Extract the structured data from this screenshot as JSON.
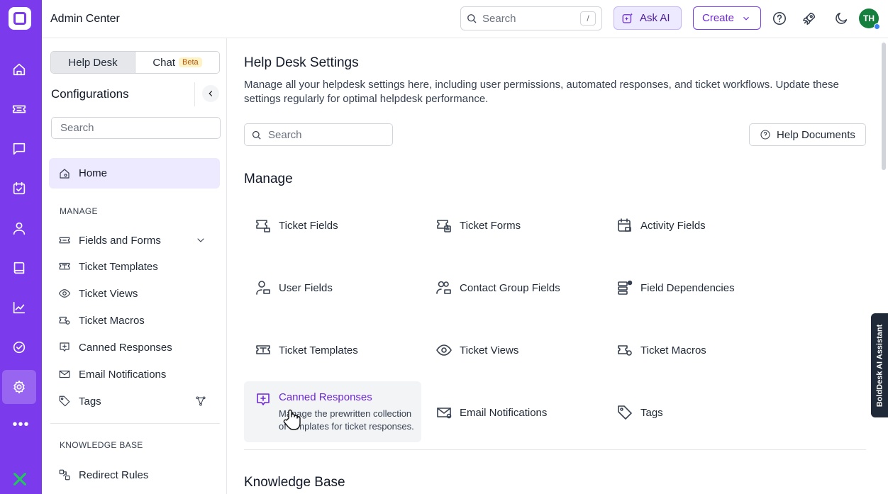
{
  "app": {
    "title": "Admin Center"
  },
  "topbar": {
    "search_placeholder": "Search",
    "search_shortcut": "/",
    "ask_ai_label": "Ask AI",
    "create_label": "Create",
    "avatar_initials": "TH"
  },
  "sidebar": {
    "tabs": [
      {
        "label": "Help Desk"
      },
      {
        "label": "Chat"
      }
    ],
    "beta_badge": "Beta",
    "title": "Configurations",
    "search_placeholder": "Search",
    "home_label": "Home",
    "manage_label": "MANAGE",
    "manage_items": [
      {
        "label": "Fields and Forms"
      },
      {
        "label": "Ticket Templates"
      },
      {
        "label": "Ticket Views"
      },
      {
        "label": "Ticket Macros"
      },
      {
        "label": "Canned Responses"
      },
      {
        "label": "Email Notifications"
      },
      {
        "label": "Tags"
      }
    ],
    "kb_label": "KNOWLEDGE BASE",
    "kb_items": [
      {
        "label": "Redirect Rules"
      }
    ]
  },
  "main": {
    "title": "Help Desk Settings",
    "description": "Manage all your helpdesk settings here, including user permissions, automated responses, and ticket workflows. Update these settings regularly for optimal helpdesk performance.",
    "search_placeholder": "Search",
    "help_docs_label": "Help Documents",
    "manage_heading": "Manage",
    "cards": [
      {
        "label": "Ticket Fields"
      },
      {
        "label": "Ticket Forms"
      },
      {
        "label": "Activity Fields"
      },
      {
        "label": "User Fields"
      },
      {
        "label": "Contact Group Fields"
      },
      {
        "label": "Field Dependencies"
      },
      {
        "label": "Ticket Templates"
      },
      {
        "label": "Ticket Views"
      },
      {
        "label": "Ticket Macros"
      },
      {
        "label": "Canned Responses",
        "description": "Manage the prewritten collection of templates for ticket responses."
      },
      {
        "label": "Email Notifications"
      },
      {
        "label": "Tags"
      }
    ],
    "kb_heading": "Knowledge Base"
  },
  "ai_assistant": {
    "label": "BoldDesk AI Assistant"
  },
  "colors": {
    "brand": "#7c3aed",
    "accent_text": "#6d28d9",
    "active_bg": "#ede9fe"
  }
}
